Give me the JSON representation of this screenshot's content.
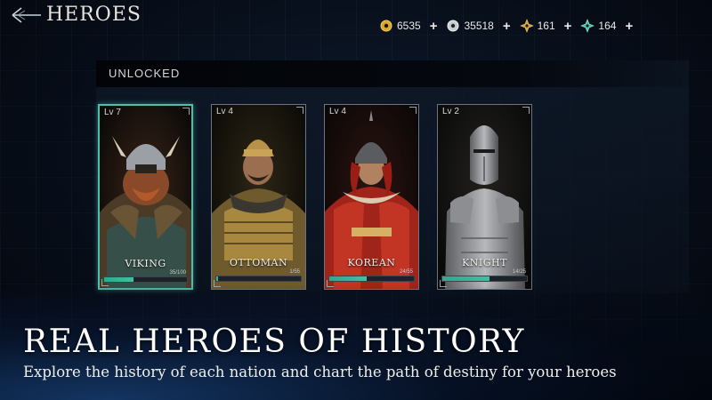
{
  "header": {
    "title": "HEROES",
    "back_icon": "arrow-back-icon"
  },
  "resources": [
    {
      "icon": "gold-coin-icon",
      "color": "#d9a62e",
      "value": "6535"
    },
    {
      "icon": "silver-coin-icon",
      "color": "#c9cdd2",
      "value": "35518"
    },
    {
      "icon": "gold-shuriken-icon",
      "color": "#d4a13a",
      "value": "161"
    },
    {
      "icon": "teal-shuriken-icon",
      "color": "#49c4a4",
      "value": "164"
    }
  ],
  "section": {
    "label": "UNLOCKED"
  },
  "heroes": [
    {
      "level": "Lv 7",
      "name": "VIKING",
      "fragments": "35/100",
      "progress": 0.35,
      "selected": true,
      "accent": "#8a4a2a"
    },
    {
      "level": "Lv 4",
      "name": "OTTOMAN",
      "fragments": "1/55",
      "progress": 0.02,
      "selected": false,
      "accent": "#9a7a3a"
    },
    {
      "level": "Lv 4",
      "name": "KOREAN",
      "fragments": "24/55",
      "progress": 0.44,
      "selected": false,
      "accent": "#b0281c"
    },
    {
      "level": "Lv 2",
      "name": "KNIGHT",
      "fragments": "14/25",
      "progress": 0.56,
      "selected": false,
      "accent": "#8c8f94"
    }
  ],
  "banner": {
    "headline": "REAL HEROES OF HISTORY",
    "subline": "Explore the history of each nation and chart the path of destiny for your heroes"
  },
  "colors": {
    "progress": "#3cc3a0",
    "selected_border": "#4fbfad"
  }
}
